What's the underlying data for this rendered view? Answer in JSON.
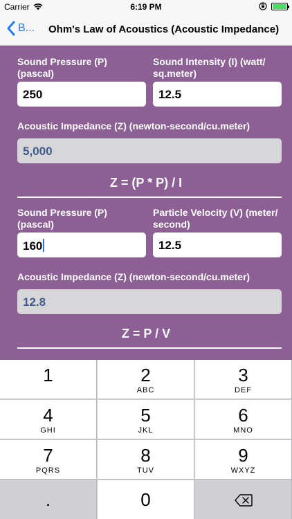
{
  "status": {
    "carrier": "Carrier",
    "time": "6:19 PM"
  },
  "nav": {
    "back_label": "B...",
    "title": "Ohm's Law of Acoustics (Acoustic Impedance)"
  },
  "section1": {
    "pressure_label": "Sound Pressure (P) (pascal)",
    "pressure_value": "250",
    "intensity_label": "Sound Intensity (I) (watt/ sq.meter)",
    "intensity_value": "12.5",
    "impedance_label": "Acoustic Impedance (Z) (newton-second/cu.meter)",
    "impedance_value": "5,000",
    "formula": "Z = (P * P) / I"
  },
  "section2": {
    "pressure_label": "Sound Pressure (P) (pascal)",
    "pressure_value": "160",
    "velocity_label": "Particle Velocity (V) (meter/ second)",
    "velocity_value": "12.5",
    "impedance_label": "Acoustic Impedance (Z) (newton-second/cu.meter)",
    "impedance_value": "12.8",
    "formula": "Z = P / V"
  },
  "keyboard": {
    "keys": [
      {
        "num": "1",
        "letters": ""
      },
      {
        "num": "2",
        "letters": "ABC"
      },
      {
        "num": "3",
        "letters": "DEF"
      },
      {
        "num": "4",
        "letters": "GHI"
      },
      {
        "num": "5",
        "letters": "JKL"
      },
      {
        "num": "6",
        "letters": "MNO"
      },
      {
        "num": "7",
        "letters": "PQRS"
      },
      {
        "num": "8",
        "letters": "TUV"
      },
      {
        "num": "9",
        "letters": "WXYZ"
      }
    ],
    "dot": ".",
    "zero": "0"
  },
  "colors": {
    "accent": "#1f7cf6",
    "background": "#8c5f95",
    "result_text": "#3f5a8a",
    "battery": "#4cd964"
  }
}
